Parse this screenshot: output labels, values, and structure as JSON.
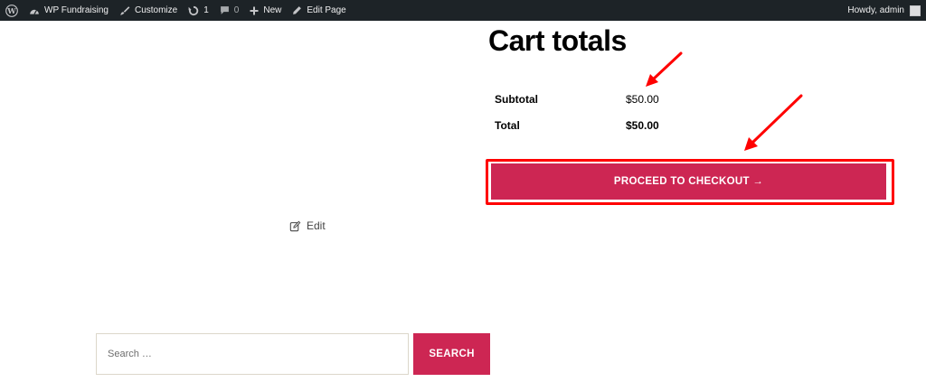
{
  "admin_bar": {
    "site_name": "WP Fundraising",
    "customize": "Customize",
    "updates_count": "1",
    "comments_count": "0",
    "new_label": "New",
    "edit_page": "Edit Page",
    "greeting": "Howdy, admin"
  },
  "cart_totals": {
    "title": "Cart totals",
    "rows": [
      {
        "label": "Subtotal",
        "value": "$50.00"
      },
      {
        "label": "Total",
        "value": "$50.00"
      }
    ],
    "checkout_label": "PROCEED TO CHECKOUT →"
  },
  "edit_link": {
    "label": "Edit"
  },
  "search": {
    "placeholder": "Search …",
    "button_label": "SEARCH"
  },
  "colors": {
    "accent": "#cd2653",
    "admin_bar": "#1d2327",
    "annotation": "#ff0000"
  },
  "icons": {
    "wordpress": "wordpress-logo-icon",
    "dashboard": "dashboard-icon",
    "customize": "brush-icon",
    "updates": "updates-icon",
    "comments": "comment-icon",
    "new": "plus-icon",
    "edit": "pencil-icon"
  }
}
